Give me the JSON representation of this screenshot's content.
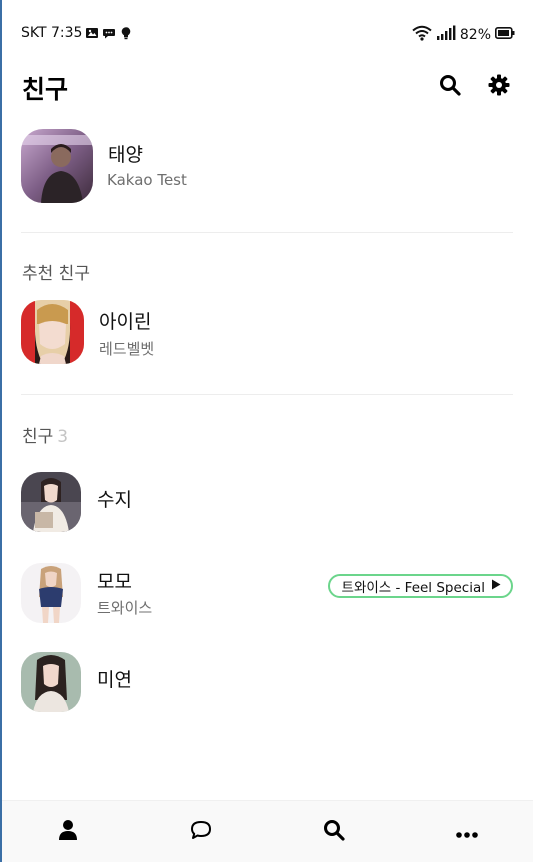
{
  "status_bar": {
    "carrier_time": "SKT 7:35",
    "battery": "82%"
  },
  "header": {
    "title": "친구"
  },
  "profile": {
    "name": "태양",
    "status": "Kakao Test"
  },
  "recommended": {
    "label": "추천 친구",
    "items": [
      {
        "name": "아이린",
        "sub": "레드벨벳"
      }
    ]
  },
  "friends": {
    "label": "친구",
    "count": "3",
    "items": [
      {
        "name": "수지",
        "sub": ""
      },
      {
        "name": "모모",
        "sub": "트와이스",
        "music": "트와이스 - Feel Special"
      },
      {
        "name": "미연",
        "sub": ""
      }
    ]
  },
  "nav": {
    "items": [
      "person-icon",
      "chat-bubble-icon",
      "search-icon",
      "more-icon"
    ]
  }
}
